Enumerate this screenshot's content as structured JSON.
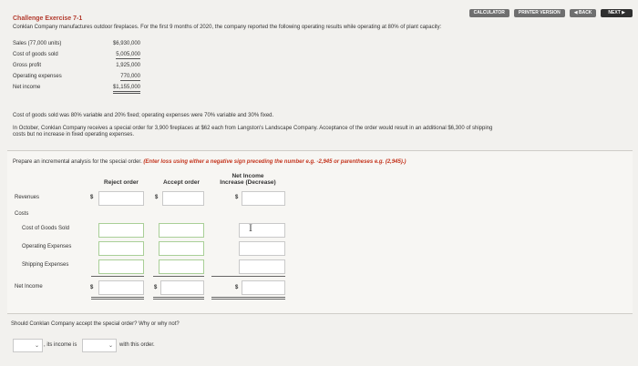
{
  "toolbar": {
    "calculator": "CALCULATOR",
    "printer_version": "PRINTER VERSION",
    "back": "◀ BACK",
    "next": "NEXT ▶"
  },
  "exercise": {
    "title": "Challenge Exercise 7-1",
    "intro": "Conklan Company manufactures outdoor fireplaces. For the first 9 months of 2020, the company reported the following operating results while operating at 80% of plant capacity:"
  },
  "results": [
    {
      "label": "Sales (77,000 units)",
      "value": "$6,930,000"
    },
    {
      "label": "Cost of goods sold",
      "value": "5,005,000"
    },
    {
      "label": "Gross profit",
      "value": "1,925,000"
    },
    {
      "label": "Operating expenses",
      "value": "770,000"
    },
    {
      "label": "Net income",
      "value": "$1,155,000"
    }
  ],
  "paragraphs": {
    "cost_note": "Cost of goods sold was 80% variable and 20% fixed; operating expenses were 70% variable and 30% fixed.",
    "order_line1": "In October, Conklan Company receives a special order for 3,900 fireplaces at $62 each from Langston's Landscape Company. Acceptance of the order would result in an additional $6,300 of shipping",
    "order_line2": "costs but no increase in fixed operating expenses."
  },
  "instructions": {
    "text": "Prepare an incremental analysis for the special order. ",
    "emphasis": "(Enter loss using either a negative sign preceding the number e.g. -2,945 or parentheses e.g. (2,945).)"
  },
  "table": {
    "col_reject": "Reject order",
    "col_accept": "Accept order",
    "col_net_line1": "Net Income",
    "col_net_line2": "Increase (Decrease)",
    "rows": {
      "revenues": "Revenues",
      "costs": "Costs",
      "cogs": "Cost of Goods Sold",
      "opex": "Operating Expenses",
      "shipping": "Shipping Expenses",
      "net_income": "Net Income"
    },
    "dollar": "$"
  },
  "question": {
    "text": "Should Conklan Company accept the special order? Why or why not?",
    "answer_mid": ", its income is",
    "answer_end": "with this order."
  }
}
